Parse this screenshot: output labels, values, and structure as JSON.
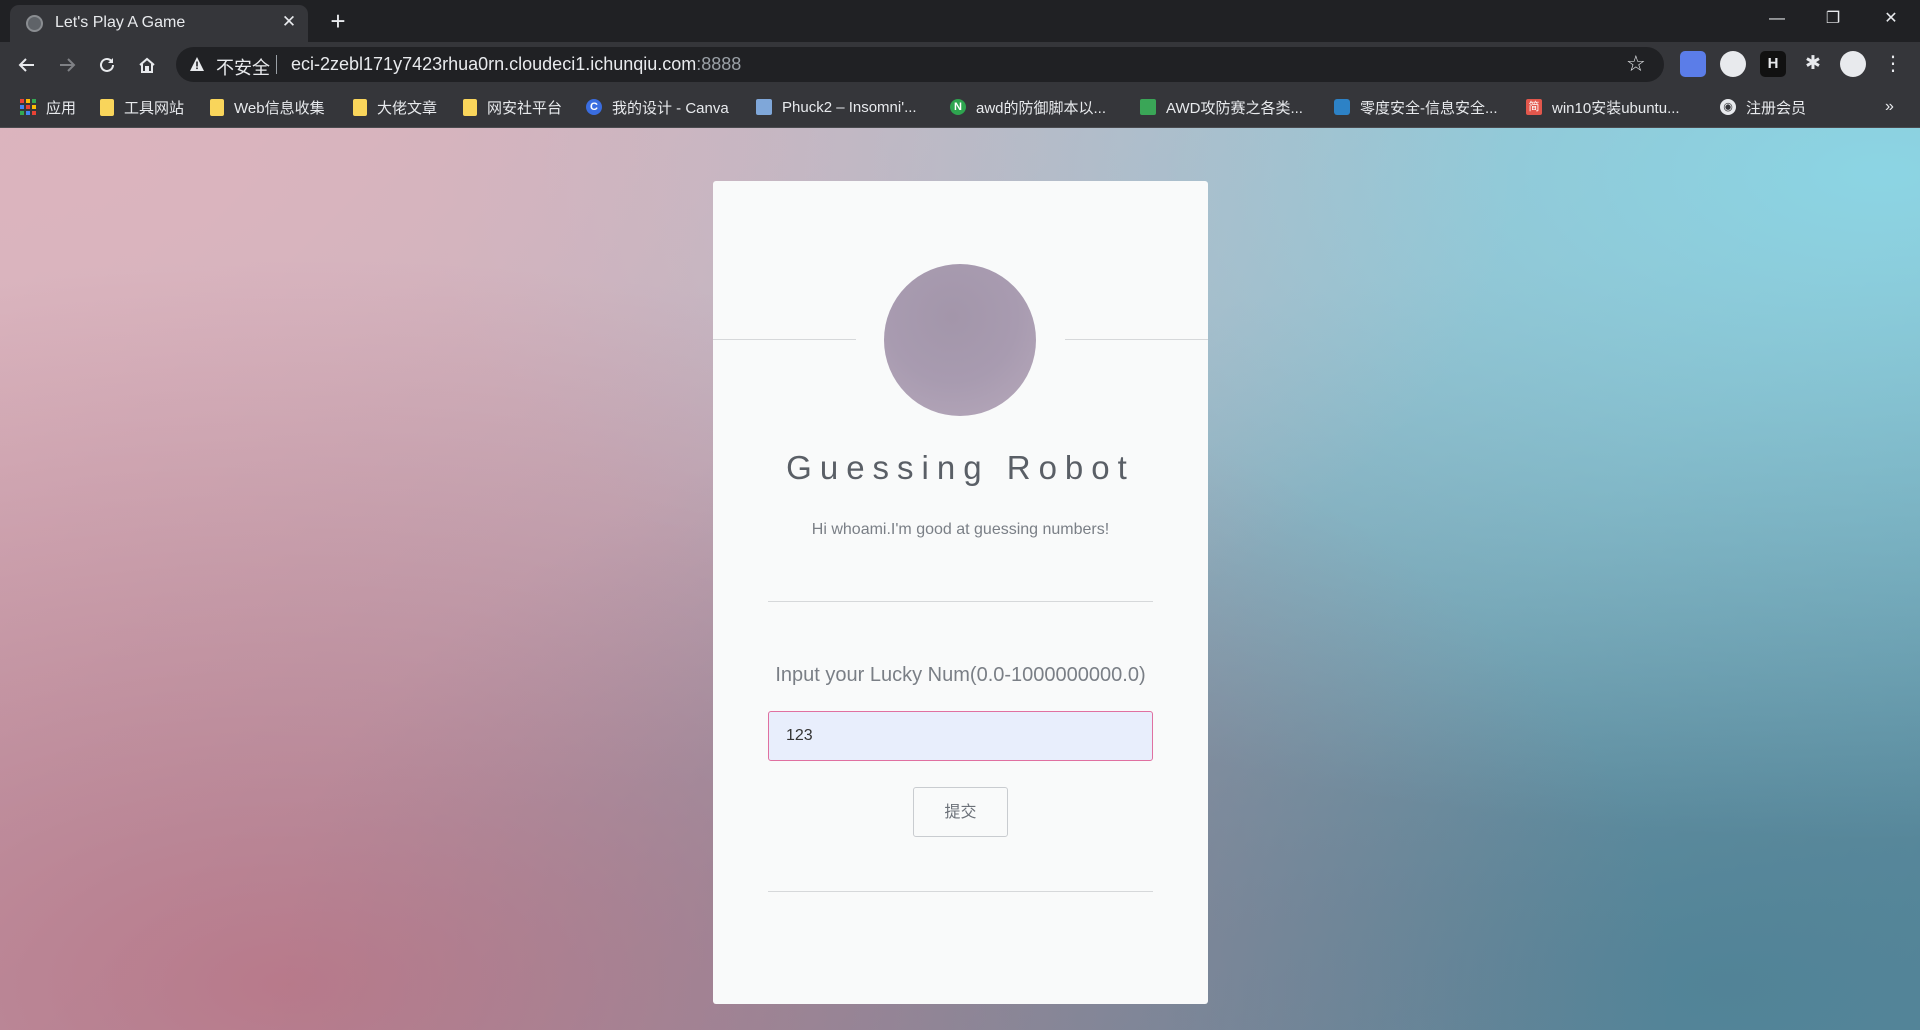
{
  "browser": {
    "tab_title": "Let's Play A Game",
    "new_tab_symbol": "+",
    "close_tab_symbol": "✕",
    "window_controls": [
      "—",
      "❐",
      "✕"
    ],
    "security_label": "不安全",
    "url_host": "eci-2zebl171y7423rhua0rn.cloudeci1.ichunqiu.com",
    "url_port": ":8888",
    "nav_icons": [
      "back-icon",
      "forward-icon",
      "reload-icon",
      "home-icon"
    ],
    "extensions": [
      "extension-blue-icon",
      "extension-fox-icon",
      "extension-h-icon",
      "puzzle-icon",
      "profile-icon",
      "menu-icon"
    ]
  },
  "bookmarks": [
    {
      "label": "应用",
      "icon": "apps-icon"
    },
    {
      "label": "工具网站",
      "icon": "folder-icon"
    },
    {
      "label": "Web信息收集",
      "icon": "folder-icon"
    },
    {
      "label": "大佬文章",
      "icon": "folder-icon"
    },
    {
      "label": "网安社平台",
      "icon": "folder-icon"
    },
    {
      "label": "我的设计 - Canva",
      "icon": "canva-icon"
    },
    {
      "label": "Phuck2 – Insomni'...",
      "icon": "page-icon"
    },
    {
      "label": "awd的防御脚本以...",
      "icon": "n-green-icon"
    },
    {
      "label": "AWD攻防赛之各类...",
      "icon": "green-bar-icon"
    },
    {
      "label": "零度安全-信息安全...",
      "icon": "zero-security-icon"
    },
    {
      "label": "win10安装ubuntu...",
      "icon": "jian-icon"
    },
    {
      "label": "注册会员",
      "icon": "globe-icon"
    }
  ],
  "bookmarks_overflow": "»",
  "card": {
    "title": "Guessing Robot",
    "subtitle": "Hi whoami.I'm good at guessing numbers!",
    "prompt": "Input your Lucky Num(0.0-1000000000.0)",
    "input_value": "123",
    "submit_label": "提交"
  },
  "colors": {
    "input_border": "#e070a0",
    "input_bg": "#e8eefc",
    "card_bg": "#f9fafa"
  }
}
